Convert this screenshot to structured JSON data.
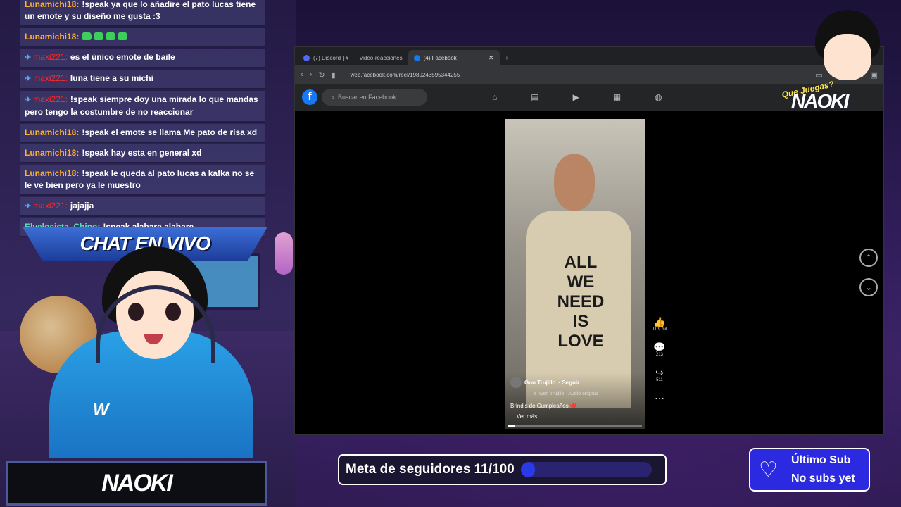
{
  "chat": {
    "title": "CHAT EN VIVO",
    "messages": [
      {
        "user": "Lunamichi18:",
        "user_color": "orange",
        "badge": false,
        "text": "!speak ya que lo añadire el pato lucas tiene un emote y su diseño me gusta :3",
        "emotes": 0
      },
      {
        "user": "Lunamichi18:",
        "user_color": "orange",
        "badge": false,
        "text": "",
        "emotes": 4
      },
      {
        "user": "maxi221:",
        "user_color": "red",
        "badge": true,
        "text": "es el único emote de baile",
        "emotes": 0
      },
      {
        "user": "maxi221:",
        "user_color": "red",
        "badge": true,
        "text": "luna tiene a su michi",
        "emotes": 0
      },
      {
        "user": "maxi221:",
        "user_color": "red",
        "badge": true,
        "text": "!speak siempre doy una mirada lo que mandas pero tengo la costumbre de no reaccionar",
        "emotes": 0
      },
      {
        "user": "Lunamichi18:",
        "user_color": "orange",
        "badge": false,
        "text": "!speak el emote se llama Me pato de risa xd",
        "emotes": 0
      },
      {
        "user": "Lunamichi18:",
        "user_color": "orange",
        "badge": false,
        "text": "!speak hay esta en general xd",
        "emotes": 0
      },
      {
        "user": "Lunamichi18:",
        "user_color": "orange",
        "badge": false,
        "text": "!speak le queda al pato lucas a kafka no se le ve bien pero ya le muestro",
        "emotes": 0
      },
      {
        "user": "maxi221:",
        "user_color": "red",
        "badge": true,
        "text": "jajajja",
        "emotes": 0
      },
      {
        "user": "Elvelocista_Chino:",
        "user_color": "teal",
        "badge": false,
        "text": "!speak alabare alabare",
        "emotes": 0
      }
    ]
  },
  "streamer_name": "NAOKI",
  "browser": {
    "tabs": [
      {
        "label": "(7) Discord | #",
        "active": false
      },
      {
        "label": "video-reacciones",
        "active": false
      },
      {
        "label": "(4) Facebook",
        "active": true
      }
    ],
    "url": "web.facebook.com/reel/1989243595344255",
    "search_placeholder": "Buscar en Facebook",
    "reel": {
      "shirt_lines": [
        "ALL",
        "WE",
        "NEED",
        "IS",
        "LOVE"
      ],
      "author": "Gon Trujillo",
      "follow": "· Seguir",
      "audio": "♬ Gon Trujillo · Audio original",
      "caption": "Brindis de Cumpleaños ❤️",
      "more": "... Ver más",
      "progress": 0.05
    },
    "actions": [
      {
        "icon": "like-icon",
        "glyph": "👍",
        "count": "11,9 mil"
      },
      {
        "icon": "comment-icon",
        "glyph": "💬",
        "count": "213"
      },
      {
        "icon": "share-icon",
        "glyph": "↪",
        "count": "511"
      },
      {
        "icon": "more-icon",
        "glyph": "⋯",
        "count": ""
      }
    ]
  },
  "branding": {
    "tagline": "Que Juegas?",
    "name": "NAOKI"
  },
  "goal": {
    "label": "Meta de seguidores 11/100",
    "current": 11,
    "target": 100,
    "fill_color": "#2a3ae8"
  },
  "last_sub": {
    "line1": "Último Sub",
    "line2": "No subs yet"
  },
  "colors": {
    "accent": "#2c2ae0",
    "chat_orange": "#ffb02e",
    "chat_red": "#ff2a2a",
    "chat_teal": "#55e0c0",
    "facebook_blue": "#1877f2"
  }
}
